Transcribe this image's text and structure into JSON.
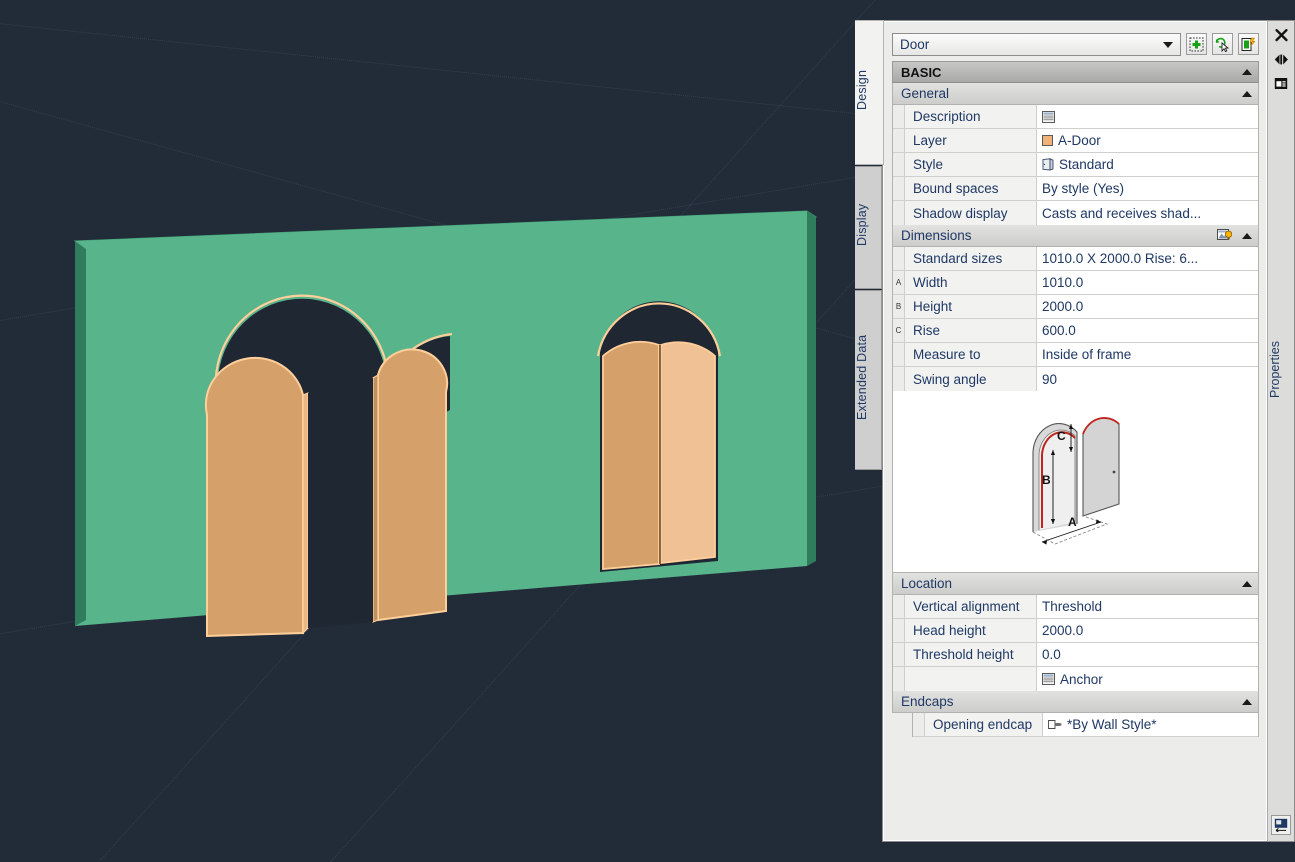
{
  "window": {
    "object_type": "Door"
  },
  "toolbar": {
    "quick_select_icon": "quick-select-icon",
    "select_objects_icon": "select-objects-icon",
    "quick_properties_icon": "quick-properties-icon"
  },
  "tabs": [
    {
      "label": "Design",
      "active": true
    },
    {
      "label": "Display",
      "active": false
    },
    {
      "label": "Extended Data",
      "active": false
    }
  ],
  "rail": {
    "title": "Properties",
    "close_icon": "close-icon",
    "autohide_icon": "auto-hide-icon",
    "menu_icon": "palette-menu-icon",
    "bottom_icon": "dock-icon"
  },
  "sections": {
    "basic": "BASIC",
    "general": "General",
    "dimensions": "Dimensions",
    "location": "Location",
    "endcaps": "Endcaps"
  },
  "general_rows": [
    {
      "marker": "",
      "name": "Description",
      "value": "",
      "icon": "description-icon"
    },
    {
      "marker": "",
      "name": "Layer",
      "value": "A-Door",
      "icon": "layer-color-swatch"
    },
    {
      "marker": "",
      "name": "Style",
      "value": "Standard",
      "icon": "door-style-icon"
    },
    {
      "marker": "",
      "name": "Bound spaces",
      "value": "By style (Yes)",
      "icon": ""
    },
    {
      "marker": "",
      "name": "Shadow display",
      "value": "Casts and receives shad...",
      "icon": ""
    }
  ],
  "dimension_rows": [
    {
      "marker": "",
      "name": "Standard sizes",
      "value": "1010.0  X  2000.0  Rise: 6...",
      "icon": ""
    },
    {
      "marker": "A",
      "name": "Width",
      "value": "1010.0",
      "icon": ""
    },
    {
      "marker": "B",
      "name": "Height",
      "value": "2000.0",
      "icon": ""
    },
    {
      "marker": "C",
      "name": "Rise",
      "value": "600.0",
      "icon": ""
    },
    {
      "marker": "",
      "name": "Measure to",
      "value": "Inside of frame",
      "icon": ""
    },
    {
      "marker": "",
      "name": "Swing angle",
      "value": "90",
      "icon": ""
    }
  ],
  "preview": {
    "name": "door-dimension-diagram",
    "labels": {
      "a": "A",
      "b": "B",
      "c": "C"
    },
    "arch_highlight_color": "#c0241f"
  },
  "location_rows": [
    {
      "marker": "",
      "name": "Vertical alignment",
      "value": "Threshold",
      "icon": ""
    },
    {
      "marker": "",
      "name": "Head height",
      "value": "2000.0",
      "icon": ""
    },
    {
      "marker": "",
      "name": "Threshold height",
      "value": "0.0",
      "icon": ""
    },
    {
      "marker": "",
      "name": "",
      "value": "Anchor",
      "icon": "anchor-icon"
    }
  ],
  "endcap_rows": [
    {
      "marker": "",
      "name": "Opening endcap",
      "value": "*By Wall Style*",
      "icon": "endcap-icon"
    }
  ],
  "viewport": {
    "background_color": "#222b38",
    "wall_color": "#57b48b",
    "wall_top_color": "#3f9a73",
    "door_color": "#d5a06a",
    "door_highlight_color": "#f5c089",
    "door_edge_color": "#ffcf9b",
    "opening_void_color": "#1f2733",
    "description": "3D shaded view: green wall with two arched door openings; left pair swung open, right pair closed"
  }
}
